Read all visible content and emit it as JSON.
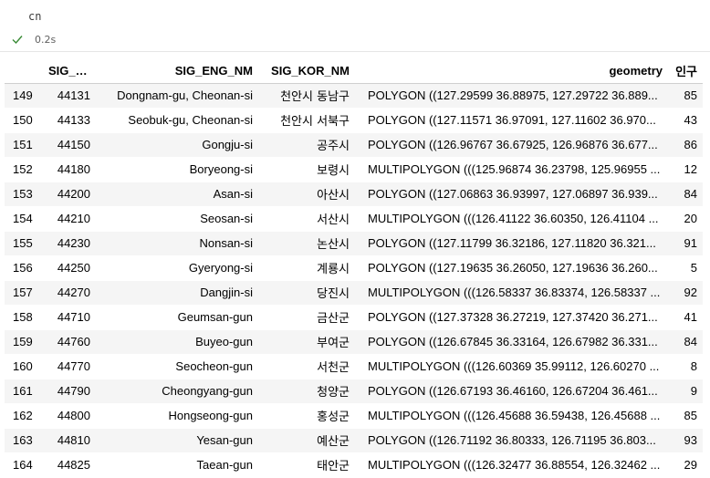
{
  "cell": {
    "code": "cn",
    "exec_time": "0.2s",
    "success_color": "#388a34"
  },
  "table": {
    "columns": [
      "",
      "SIG_CD",
      "SIG_ENG_NM",
      "SIG_KOR_NM",
      "geometry",
      "인구"
    ],
    "rows": [
      {
        "idx": "149",
        "sig_cd": "44131",
        "eng": "Dongnam-gu, Cheonan-si",
        "kor": "천안시 동남구",
        "geometry": "POLYGON ((127.29599 36.88975, 127.29722 36.889...",
        "pop": "85"
      },
      {
        "idx": "150",
        "sig_cd": "44133",
        "eng": "Seobuk-gu, Cheonan-si",
        "kor": "천안시 서북구",
        "geometry": "POLYGON ((127.11571 36.97091, 127.11602 36.970...",
        "pop": "43"
      },
      {
        "idx": "151",
        "sig_cd": "44150",
        "eng": "Gongju-si",
        "kor": "공주시",
        "geometry": "POLYGON ((126.96767 36.67925, 126.96876 36.677...",
        "pop": "86"
      },
      {
        "idx": "152",
        "sig_cd": "44180",
        "eng": "Boryeong-si",
        "kor": "보령시",
        "geometry": "MULTIPOLYGON (((125.96874 36.23798, 125.96955 ...",
        "pop": "12"
      },
      {
        "idx": "153",
        "sig_cd": "44200",
        "eng": "Asan-si",
        "kor": "아산시",
        "geometry": "POLYGON ((127.06863 36.93997, 127.06897 36.939...",
        "pop": "84"
      },
      {
        "idx": "154",
        "sig_cd": "44210",
        "eng": "Seosan-si",
        "kor": "서산시",
        "geometry": "MULTIPOLYGON (((126.41122 36.60350, 126.41104 ...",
        "pop": "20"
      },
      {
        "idx": "155",
        "sig_cd": "44230",
        "eng": "Nonsan-si",
        "kor": "논산시",
        "geometry": "POLYGON ((127.11799 36.32186, 127.11820 36.321...",
        "pop": "91"
      },
      {
        "idx": "156",
        "sig_cd": "44250",
        "eng": "Gyeryong-si",
        "kor": "계룡시",
        "geometry": "POLYGON ((127.19635 36.26050, 127.19636 36.260...",
        "pop": "5"
      },
      {
        "idx": "157",
        "sig_cd": "44270",
        "eng": "Dangjin-si",
        "kor": "당진시",
        "geometry": "MULTIPOLYGON (((126.58337 36.83374, 126.58337 ...",
        "pop": "92"
      },
      {
        "idx": "158",
        "sig_cd": "44710",
        "eng": "Geumsan-gun",
        "kor": "금산군",
        "geometry": "POLYGON ((127.37328 36.27219, 127.37420 36.271...",
        "pop": "41"
      },
      {
        "idx": "159",
        "sig_cd": "44760",
        "eng": "Buyeo-gun",
        "kor": "부여군",
        "geometry": "POLYGON ((126.67845 36.33164, 126.67982 36.331...",
        "pop": "84"
      },
      {
        "idx": "160",
        "sig_cd": "44770",
        "eng": "Seocheon-gun",
        "kor": "서천군",
        "geometry": "MULTIPOLYGON (((126.60369 35.99112, 126.60270 ...",
        "pop": "8"
      },
      {
        "idx": "161",
        "sig_cd": "44790",
        "eng": "Cheongyang-gun",
        "kor": "청양군",
        "geometry": "POLYGON ((126.67193 36.46160, 126.67204 36.461...",
        "pop": "9"
      },
      {
        "idx": "162",
        "sig_cd": "44800",
        "eng": "Hongseong-gun",
        "kor": "홍성군",
        "geometry": "MULTIPOLYGON (((126.45688 36.59438, 126.45688 ...",
        "pop": "85"
      },
      {
        "idx": "163",
        "sig_cd": "44810",
        "eng": "Yesan-gun",
        "kor": "예산군",
        "geometry": "POLYGON ((126.71192 36.80333, 126.71195 36.803...",
        "pop": "93"
      },
      {
        "idx": "164",
        "sig_cd": "44825",
        "eng": "Taean-gun",
        "kor": "태안군",
        "geometry": "MULTIPOLYGON (((126.32477 36.88554, 126.32462 ...",
        "pop": "29"
      }
    ]
  }
}
